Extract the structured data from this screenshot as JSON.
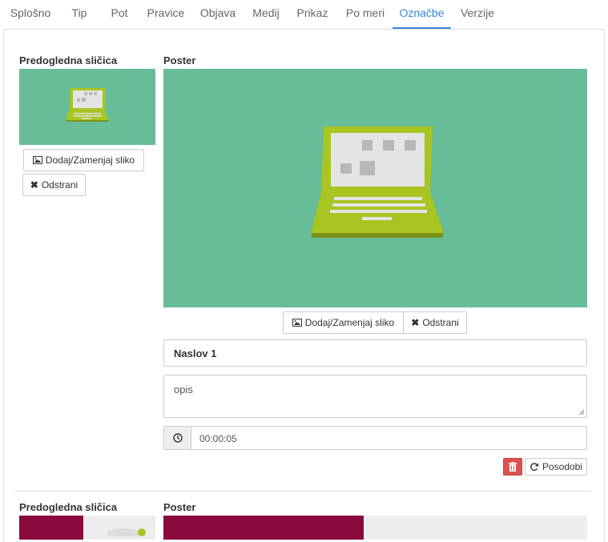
{
  "tabs": [
    {
      "label": "Splošno"
    },
    {
      "label": "Tip"
    },
    {
      "label": "Pot"
    },
    {
      "label": "Pravice"
    },
    {
      "label": "Objava"
    },
    {
      "label": "Medij"
    },
    {
      "label": "Prikaz"
    },
    {
      "label": "Po meri"
    },
    {
      "label": "Označbe",
      "active": true
    },
    {
      "label": "Verzije"
    }
  ],
  "marker1": {
    "thumb_label": "Predogledna sličica",
    "poster_label": "Poster",
    "thumb_add": "Dodaj/Zamenjaj sliko",
    "thumb_remove": "Odstrani",
    "poster_add": "Dodaj/Zamenjaj sliko",
    "poster_remove": "Odstrani",
    "title_value": "Naslov 1",
    "description_value": "opis",
    "time_value": "00:00:05",
    "update_label": "Posodobi"
  },
  "marker2": {
    "thumb_label": "Predogledna sličica",
    "poster_label": "Poster"
  },
  "colors": {
    "accent": "#3b86d8",
    "image_bg": "#66bd98",
    "laptop": "#a8c521",
    "danger": "#d9534f",
    "second_image": "#8b0a3e"
  }
}
